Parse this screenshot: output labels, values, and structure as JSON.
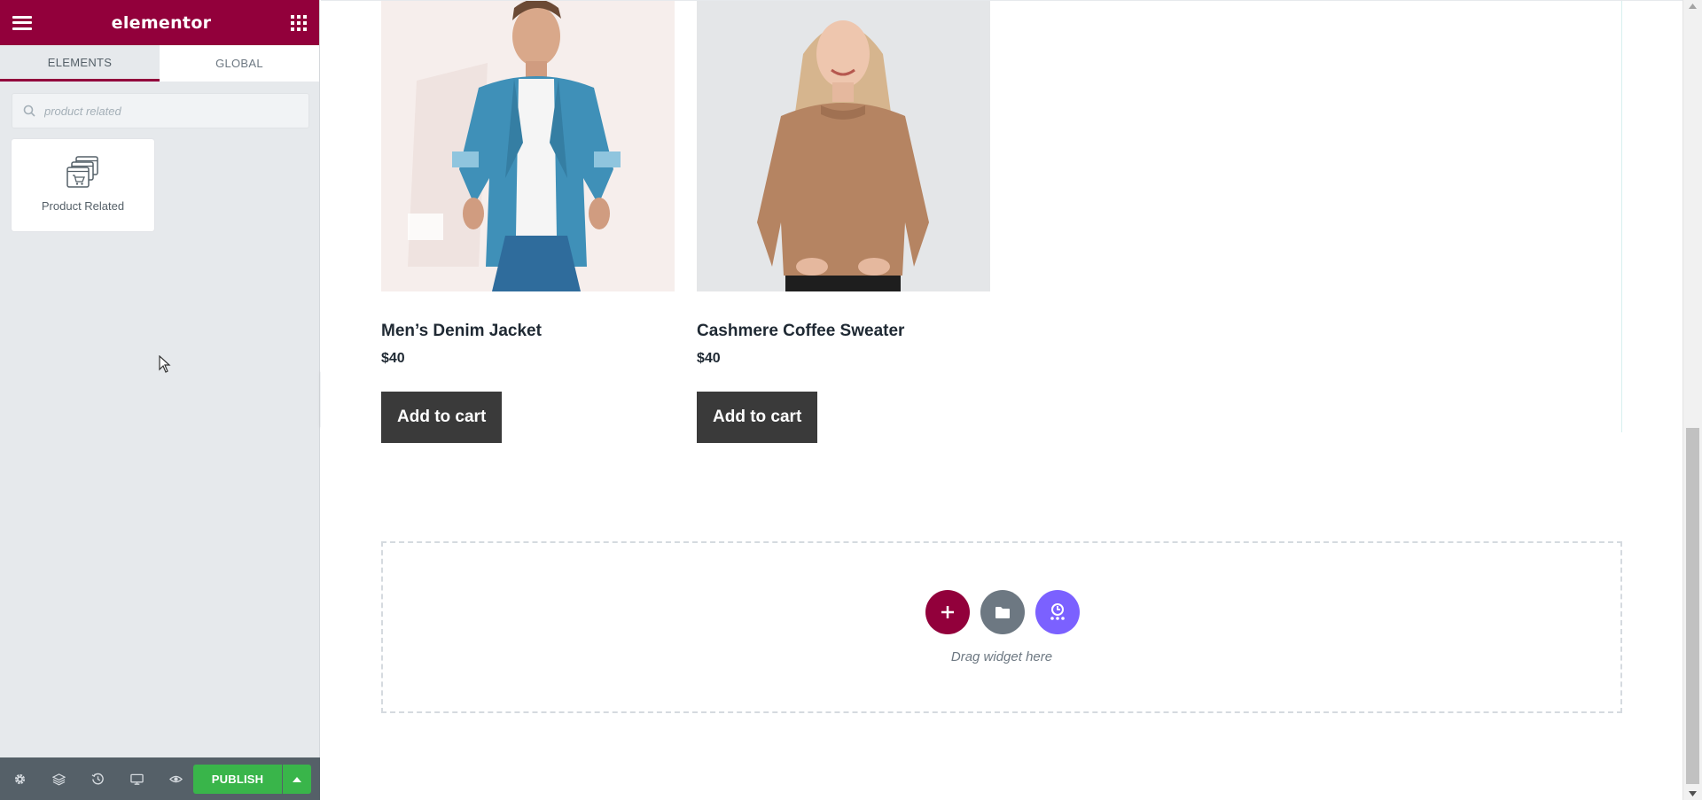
{
  "panel": {
    "logo": "elementor",
    "tabs": [
      {
        "label": "ELEMENTS"
      },
      {
        "label": "GLOBAL"
      }
    ],
    "search": {
      "value": "",
      "placeholder": "product related"
    },
    "widget": {
      "label": "Product Related",
      "icon": "product-related-icon"
    },
    "footer": {
      "icons": [
        "settings-icon",
        "navigator-icon",
        "history-icon",
        "responsive-mode-icon",
        "preview-icon"
      ],
      "publish_label": "PUBLISH"
    },
    "accent_color": "#92003b",
    "publish_color": "#39b54a"
  },
  "products": [
    {
      "title": "Men’s Denim Jacket",
      "price": "$40",
      "button": "Add to cart"
    },
    {
      "title": "Cashmere Coffee Sweater",
      "price": "$40",
      "button": "Add to cart"
    }
  ],
  "drop_zone": {
    "label": "Drag widget here",
    "buttons": [
      "add-section-icon",
      "template-library-icon",
      "ai-icon"
    ]
  }
}
